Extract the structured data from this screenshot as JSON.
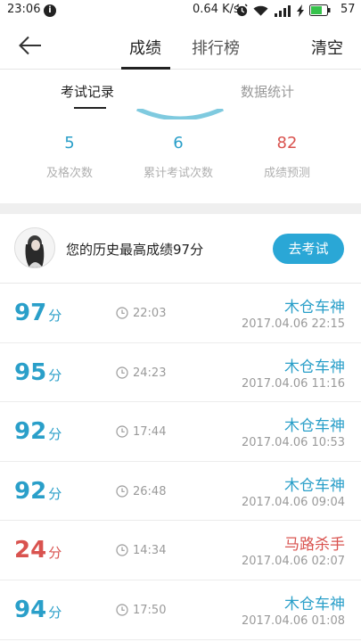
{
  "status_bar": {
    "time": "23:06",
    "notif_icon": "info-icon",
    "speed": "0.64 K/s",
    "battery": "57",
    "icons": [
      "alarm-icon",
      "wifi-icon",
      "signal-icon",
      "charging-icon",
      "battery-icon"
    ]
  },
  "header": {
    "back_icon": "back-arrow-icon",
    "tabs": [
      {
        "label": "成绩",
        "active": true
      },
      {
        "label": "排行榜",
        "active": false
      }
    ],
    "clear_label": "清空"
  },
  "subtabs": [
    {
      "label": "考试记录",
      "active": true
    },
    {
      "label": "数据统计",
      "active": false
    }
  ],
  "stats": [
    {
      "value": "5",
      "label": "及格次数",
      "color": "#2a9fc9"
    },
    {
      "value": "6",
      "label": "累计考试次数",
      "color": "#2a9fc9"
    },
    {
      "value": "82",
      "label": "成绩预测",
      "color": "#d9534f"
    }
  ],
  "best": {
    "text": "您的历史最高成绩97分",
    "button_label": "去考试"
  },
  "records": [
    {
      "score": "97",
      "unit": "分",
      "duration": "22:03",
      "title": "木仓车神",
      "date": "2017.04.06  22:15",
      "pass": true
    },
    {
      "score": "95",
      "unit": "分",
      "duration": "24:23",
      "title": "木仓车神",
      "date": "2017.04.06  11:16",
      "pass": true
    },
    {
      "score": "92",
      "unit": "分",
      "duration": "17:44",
      "title": "木仓车神",
      "date": "2017.04.06  10:53",
      "pass": true
    },
    {
      "score": "92",
      "unit": "分",
      "duration": "26:48",
      "title": "木仓车神",
      "date": "2017.04.06  09:04",
      "pass": true
    },
    {
      "score": "24",
      "unit": "分",
      "duration": "14:34",
      "title": "马路杀手",
      "date": "2017.04.06  02:07",
      "pass": false
    },
    {
      "score": "94",
      "unit": "分",
      "duration": "17:50",
      "title": "木仓车神",
      "date": "2017.04.06  01:08",
      "pass": true
    }
  ],
  "colors": {
    "pass": "#2a9fc9",
    "fail": "#d9534f",
    "accent": "#2aa7d6"
  }
}
